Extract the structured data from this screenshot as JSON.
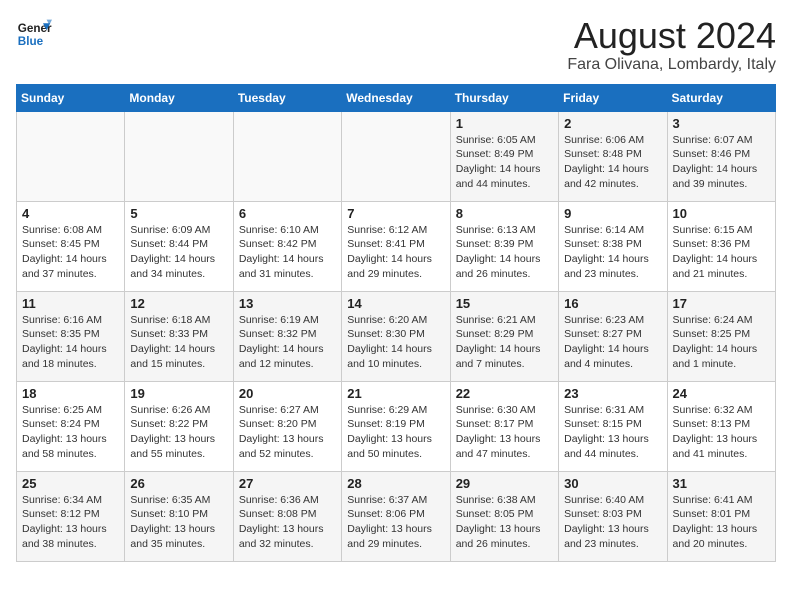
{
  "header": {
    "logo_line1": "General",
    "logo_line2": "Blue",
    "month_year": "August 2024",
    "location": "Fara Olivana, Lombardy, Italy"
  },
  "weekdays": [
    "Sunday",
    "Monday",
    "Tuesday",
    "Wednesday",
    "Thursday",
    "Friday",
    "Saturday"
  ],
  "weeks": [
    [
      {
        "day": "",
        "info": ""
      },
      {
        "day": "",
        "info": ""
      },
      {
        "day": "",
        "info": ""
      },
      {
        "day": "",
        "info": ""
      },
      {
        "day": "1",
        "info": "Sunrise: 6:05 AM\nSunset: 8:49 PM\nDaylight: 14 hours and 44 minutes."
      },
      {
        "day": "2",
        "info": "Sunrise: 6:06 AM\nSunset: 8:48 PM\nDaylight: 14 hours and 42 minutes."
      },
      {
        "day": "3",
        "info": "Sunrise: 6:07 AM\nSunset: 8:46 PM\nDaylight: 14 hours and 39 minutes."
      }
    ],
    [
      {
        "day": "4",
        "info": "Sunrise: 6:08 AM\nSunset: 8:45 PM\nDaylight: 14 hours and 37 minutes."
      },
      {
        "day": "5",
        "info": "Sunrise: 6:09 AM\nSunset: 8:44 PM\nDaylight: 14 hours and 34 minutes."
      },
      {
        "day": "6",
        "info": "Sunrise: 6:10 AM\nSunset: 8:42 PM\nDaylight: 14 hours and 31 minutes."
      },
      {
        "day": "7",
        "info": "Sunrise: 6:12 AM\nSunset: 8:41 PM\nDaylight: 14 hours and 29 minutes."
      },
      {
        "day": "8",
        "info": "Sunrise: 6:13 AM\nSunset: 8:39 PM\nDaylight: 14 hours and 26 minutes."
      },
      {
        "day": "9",
        "info": "Sunrise: 6:14 AM\nSunset: 8:38 PM\nDaylight: 14 hours and 23 minutes."
      },
      {
        "day": "10",
        "info": "Sunrise: 6:15 AM\nSunset: 8:36 PM\nDaylight: 14 hours and 21 minutes."
      }
    ],
    [
      {
        "day": "11",
        "info": "Sunrise: 6:16 AM\nSunset: 8:35 PM\nDaylight: 14 hours and 18 minutes."
      },
      {
        "day": "12",
        "info": "Sunrise: 6:18 AM\nSunset: 8:33 PM\nDaylight: 14 hours and 15 minutes."
      },
      {
        "day": "13",
        "info": "Sunrise: 6:19 AM\nSunset: 8:32 PM\nDaylight: 14 hours and 12 minutes."
      },
      {
        "day": "14",
        "info": "Sunrise: 6:20 AM\nSunset: 8:30 PM\nDaylight: 14 hours and 10 minutes."
      },
      {
        "day": "15",
        "info": "Sunrise: 6:21 AM\nSunset: 8:29 PM\nDaylight: 14 hours and 7 minutes."
      },
      {
        "day": "16",
        "info": "Sunrise: 6:23 AM\nSunset: 8:27 PM\nDaylight: 14 hours and 4 minutes."
      },
      {
        "day": "17",
        "info": "Sunrise: 6:24 AM\nSunset: 8:25 PM\nDaylight: 14 hours and 1 minute."
      }
    ],
    [
      {
        "day": "18",
        "info": "Sunrise: 6:25 AM\nSunset: 8:24 PM\nDaylight: 13 hours and 58 minutes."
      },
      {
        "day": "19",
        "info": "Sunrise: 6:26 AM\nSunset: 8:22 PM\nDaylight: 13 hours and 55 minutes."
      },
      {
        "day": "20",
        "info": "Sunrise: 6:27 AM\nSunset: 8:20 PM\nDaylight: 13 hours and 52 minutes."
      },
      {
        "day": "21",
        "info": "Sunrise: 6:29 AM\nSunset: 8:19 PM\nDaylight: 13 hours and 50 minutes."
      },
      {
        "day": "22",
        "info": "Sunrise: 6:30 AM\nSunset: 8:17 PM\nDaylight: 13 hours and 47 minutes."
      },
      {
        "day": "23",
        "info": "Sunrise: 6:31 AM\nSunset: 8:15 PM\nDaylight: 13 hours and 44 minutes."
      },
      {
        "day": "24",
        "info": "Sunrise: 6:32 AM\nSunset: 8:13 PM\nDaylight: 13 hours and 41 minutes."
      }
    ],
    [
      {
        "day": "25",
        "info": "Sunrise: 6:34 AM\nSunset: 8:12 PM\nDaylight: 13 hours and 38 minutes."
      },
      {
        "day": "26",
        "info": "Sunrise: 6:35 AM\nSunset: 8:10 PM\nDaylight: 13 hours and 35 minutes."
      },
      {
        "day": "27",
        "info": "Sunrise: 6:36 AM\nSunset: 8:08 PM\nDaylight: 13 hours and 32 minutes."
      },
      {
        "day": "28",
        "info": "Sunrise: 6:37 AM\nSunset: 8:06 PM\nDaylight: 13 hours and 29 minutes."
      },
      {
        "day": "29",
        "info": "Sunrise: 6:38 AM\nSunset: 8:05 PM\nDaylight: 13 hours and 26 minutes."
      },
      {
        "day": "30",
        "info": "Sunrise: 6:40 AM\nSunset: 8:03 PM\nDaylight: 13 hours and 23 minutes."
      },
      {
        "day": "31",
        "info": "Sunrise: 6:41 AM\nSunset: 8:01 PM\nDaylight: 13 hours and 20 minutes."
      }
    ]
  ]
}
